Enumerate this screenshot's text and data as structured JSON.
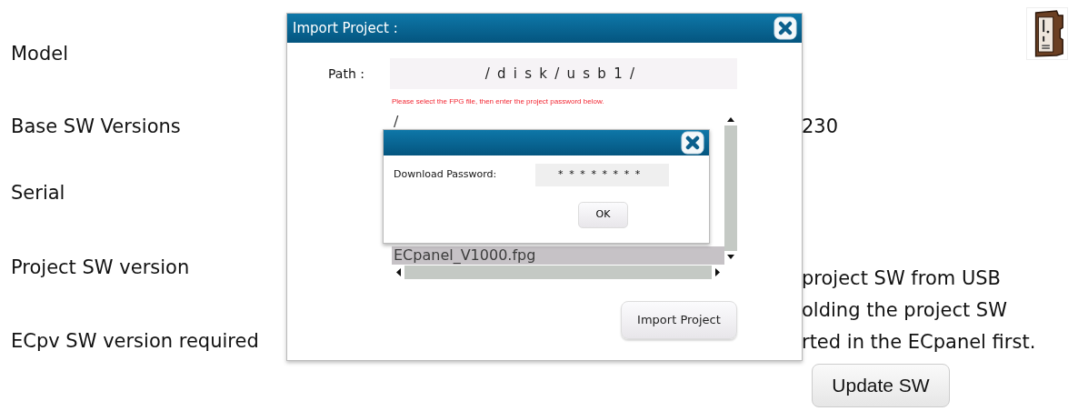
{
  "background": {
    "rows": [
      {
        "label": "Model"
      },
      {
        "label": "Base SW Versions",
        "value": "230"
      },
      {
        "label": "Serial"
      },
      {
        "label": "Project SW version"
      },
      {
        "label": "ECpv SW version required"
      }
    ],
    "note_lines": [
      "project SW from USB",
      "olding the project SW",
      "rted in the ECpanel first."
    ],
    "update_button": "Update SW"
  },
  "import_dialog": {
    "title": "Import Project :",
    "path_label": "Path :",
    "path": "/disk/usb1/",
    "hint": "Please select the FPG file, then enter the project password below.",
    "files": [
      {
        "name": "/",
        "selected": false
      },
      {
        "name": "ECpanel_V1000.fpg",
        "selected": true
      }
    ],
    "import_button": "Import Project"
  },
  "password_dialog": {
    "label": "Download Password:",
    "value": "********",
    "ok_button": "OK"
  }
}
